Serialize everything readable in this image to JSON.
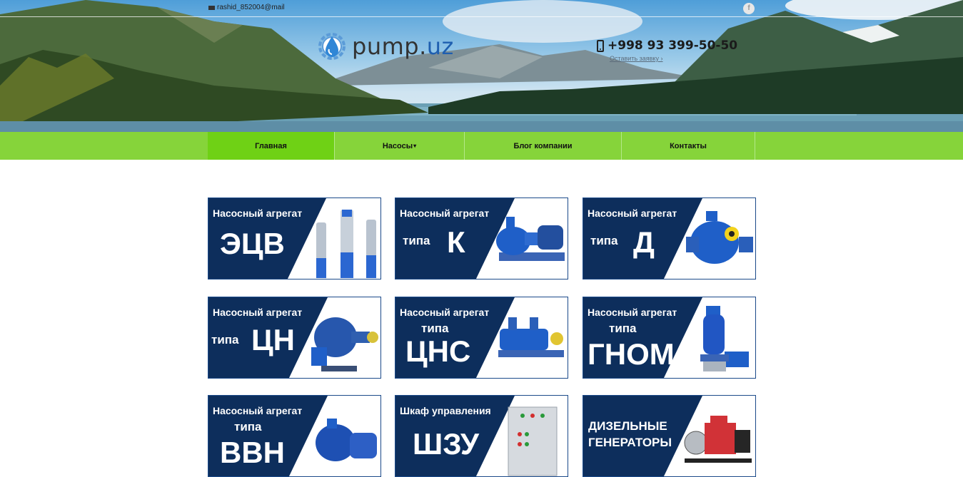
{
  "header": {
    "email": "rashid_852004@mail",
    "facebook_icon": "f",
    "logo": {
      "main": "pump",
      "dot": ".",
      "tld": "uz"
    },
    "phone": "+998 93 399-50-50",
    "request_link": "Оставить заявку ›"
  },
  "nav": {
    "items": [
      {
        "label": "Главная",
        "active": true
      },
      {
        "label": "Насосы",
        "caret": "▾"
      },
      {
        "label": "Блог компании"
      },
      {
        "label": "Контакты"
      }
    ]
  },
  "cards": [
    {
      "line1": "Насосный агрегат",
      "mid": "",
      "big": "ЭЦВ"
    },
    {
      "line1": "Насосный агрегат",
      "mid": "типа",
      "big": "К"
    },
    {
      "line1": "Насосный агрегат",
      "mid": "типа",
      "big": "Д"
    },
    {
      "line1": "Насосный агрегат",
      "mid": "типа",
      "big": "ЦН"
    },
    {
      "line1": "Насосный агрегат",
      "mid": "типа",
      "big": "ЦНС"
    },
    {
      "line1": "Насосный агрегат",
      "mid": "типа",
      "big": "ГНОМ"
    },
    {
      "line1": "Насосный агрегат",
      "mid": "типа",
      "big": "ВВН"
    },
    {
      "line1": "Шкаф управления",
      "mid": "",
      "big": "ШЗУ"
    },
    {
      "line1": "ДИЗЕЛЬНЫЕ",
      "mid": "ГЕНЕРАТОРЫ",
      "big": ""
    }
  ],
  "colors": {
    "nav": "#86d43a",
    "nav_active": "#6fd115",
    "card_navy": "#0d2e5c",
    "pump_blue": "#1f5fc8",
    "logo_blue": "#1f5fb0"
  }
}
